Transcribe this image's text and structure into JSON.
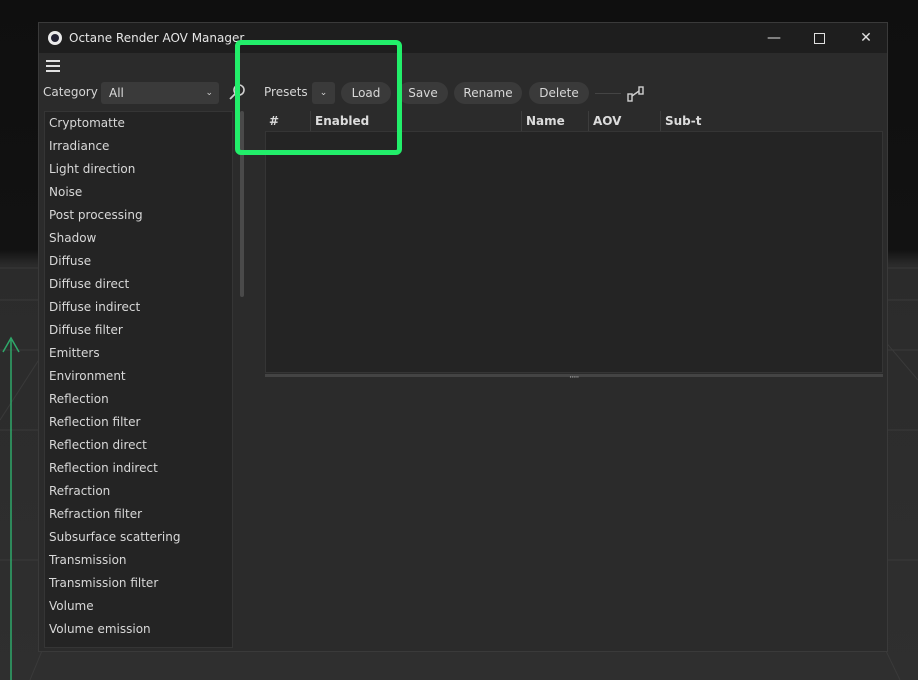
{
  "window": {
    "title": "Octane Render AOV Manager"
  },
  "category": {
    "label": "Category",
    "selected": "All"
  },
  "categories": [
    "Cryptomatte",
    "Irradiance",
    "Light direction",
    "Noise",
    "Post processing",
    "Shadow",
    "Diffuse",
    "Diffuse direct",
    "Diffuse indirect",
    "Diffuse filter",
    "Emitters",
    "Environment",
    "Reflection",
    "Reflection filter",
    "Reflection direct",
    "Reflection indirect",
    "Refraction",
    "Refraction filter",
    "Subsurface scattering",
    "Transmission",
    "Transmission filter",
    "Volume",
    "Volume emission"
  ],
  "presets": {
    "label": "Presets",
    "load": "Load",
    "save": "Save",
    "rename": "Rename",
    "delete": "Delete"
  },
  "table": {
    "headers": [
      "#",
      "Enabled",
      "Name",
      "AOV",
      "Sub-t"
    ]
  },
  "colors": {
    "highlight": "#22ee6a",
    "background": "#2b2b2b"
  }
}
